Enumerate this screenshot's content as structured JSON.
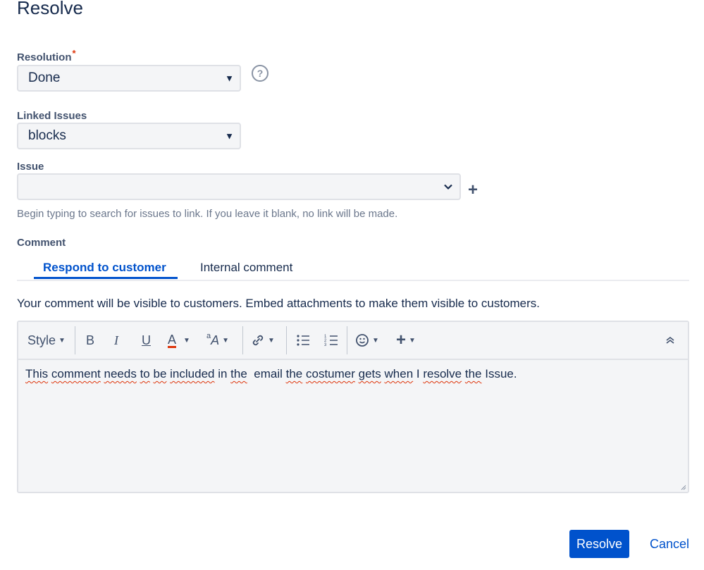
{
  "dialog": {
    "title": "Resolve"
  },
  "resolution": {
    "label": "Resolution",
    "required_mark": "*",
    "value": "Done",
    "help_icon": "question-circle-icon"
  },
  "linked_issues": {
    "label": "Linked Issues",
    "value": "blocks"
  },
  "issue": {
    "label": "Issue",
    "value": "",
    "hint": "Begin typing to search for issues to link. If you leave it blank, no link will be made."
  },
  "comment": {
    "label": "Comment",
    "tabs": [
      {
        "label": "Respond to customer",
        "active": true
      },
      {
        "label": "Internal comment",
        "active": false
      }
    ],
    "visibility_note": "Your comment will be visible to customers. Embed attachments to make them visible to customers.",
    "toolbar": {
      "style_label": "Style",
      "bold": "B",
      "italic": "I",
      "underline": "U",
      "text_color": "A"
    },
    "text_parts": [
      {
        "t": "This",
        "spell": true
      },
      {
        "t": " ",
        "spell": false
      },
      {
        "t": "comment",
        "spell": true
      },
      {
        "t": " ",
        "spell": false
      },
      {
        "t": "needs",
        "spell": true
      },
      {
        "t": " ",
        "spell": false
      },
      {
        "t": "to",
        "spell": true
      },
      {
        "t": " ",
        "spell": false
      },
      {
        "t": "be",
        "spell": true
      },
      {
        "t": " ",
        "spell": false
      },
      {
        "t": "included",
        "spell": true
      },
      {
        "t": " in ",
        "spell": false
      },
      {
        "t": "the",
        "spell": true
      },
      {
        "t": "  email ",
        "spell": false
      },
      {
        "t": "the",
        "spell": true
      },
      {
        "t": " ",
        "spell": false
      },
      {
        "t": "costumer",
        "spell": true
      },
      {
        "t": " ",
        "spell": false
      },
      {
        "t": "gets",
        "spell": true
      },
      {
        "t": " ",
        "spell": false
      },
      {
        "t": "when",
        "spell": true
      },
      {
        "t": " I ",
        "spell": false
      },
      {
        "t": "resolve",
        "spell": true
      },
      {
        "t": " ",
        "spell": false
      },
      {
        "t": "the",
        "spell": true
      },
      {
        "t": " Issue.",
        "spell": false
      }
    ]
  },
  "actions": {
    "primary": "Resolve",
    "cancel": "Cancel"
  },
  "colors": {
    "accent": "#0052cc",
    "required": "#de350b"
  }
}
